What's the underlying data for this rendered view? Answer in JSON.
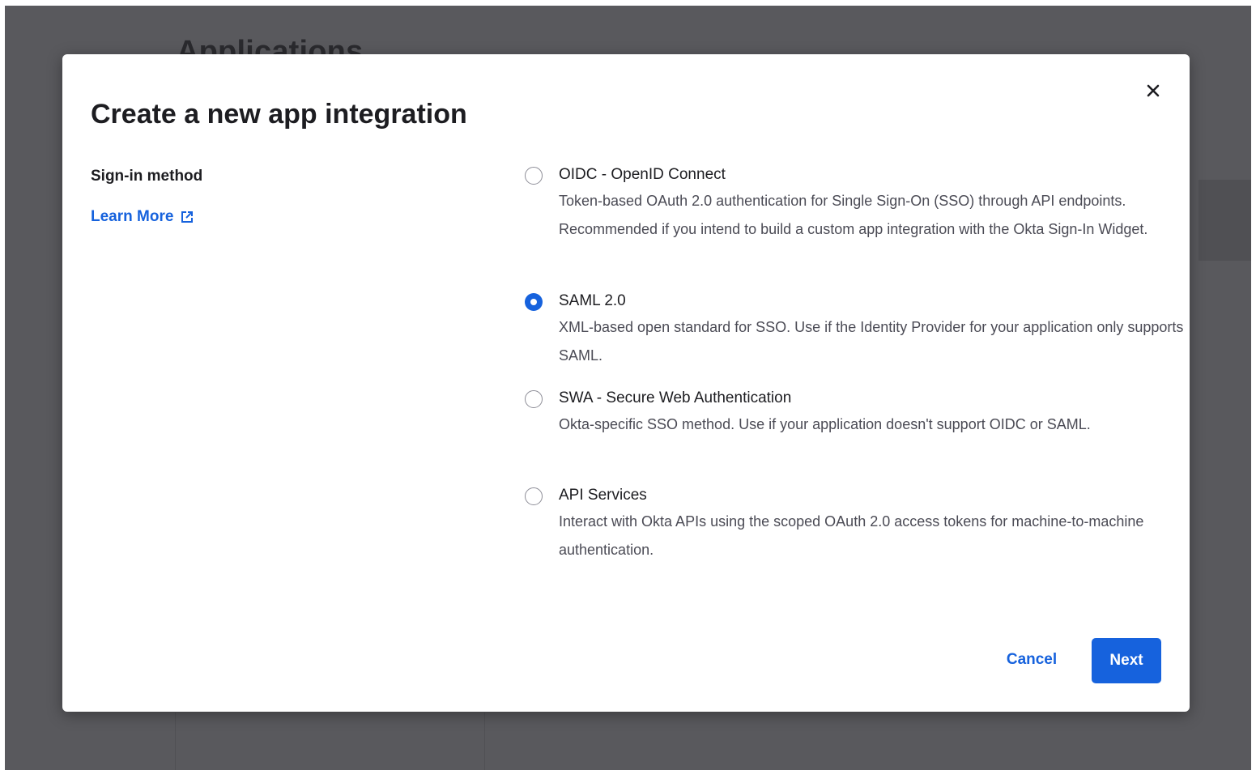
{
  "background": {
    "page_title": "Applications"
  },
  "modal": {
    "title": "Create a new app integration",
    "close_icon": "close-icon",
    "sign_in_label": "Sign-in method",
    "learn_more": "Learn More",
    "learn_more_icon": "external-link-icon",
    "options": [
      {
        "label": "OIDC - OpenID Connect",
        "description": "Token-based OAuth 2.0 authentication for Single Sign-On (SSO) through API endpoints. Recommended if you intend to build a custom app integration with the Okta Sign-In Widget.",
        "checked": false
      },
      {
        "label": "SAML 2.0",
        "description": "XML-based open standard for SSO. Use if the Identity Provider for your application only supports SAML.",
        "checked": true
      },
      {
        "label": "SWA - Secure Web Authentication",
        "description": "Okta-specific SSO method. Use if your application doesn't support OIDC or SAML.",
        "checked": false
      },
      {
        "label": "API Services",
        "description": "Interact with Okta APIs using the scoped OAuth 2.0 access tokens for machine-to-machine authentication.",
        "checked": false
      }
    ],
    "cancel_label": "Cancel",
    "next_label": "Next"
  },
  "colors": {
    "accent": "#1662dd",
    "overlay": "#59595d"
  }
}
